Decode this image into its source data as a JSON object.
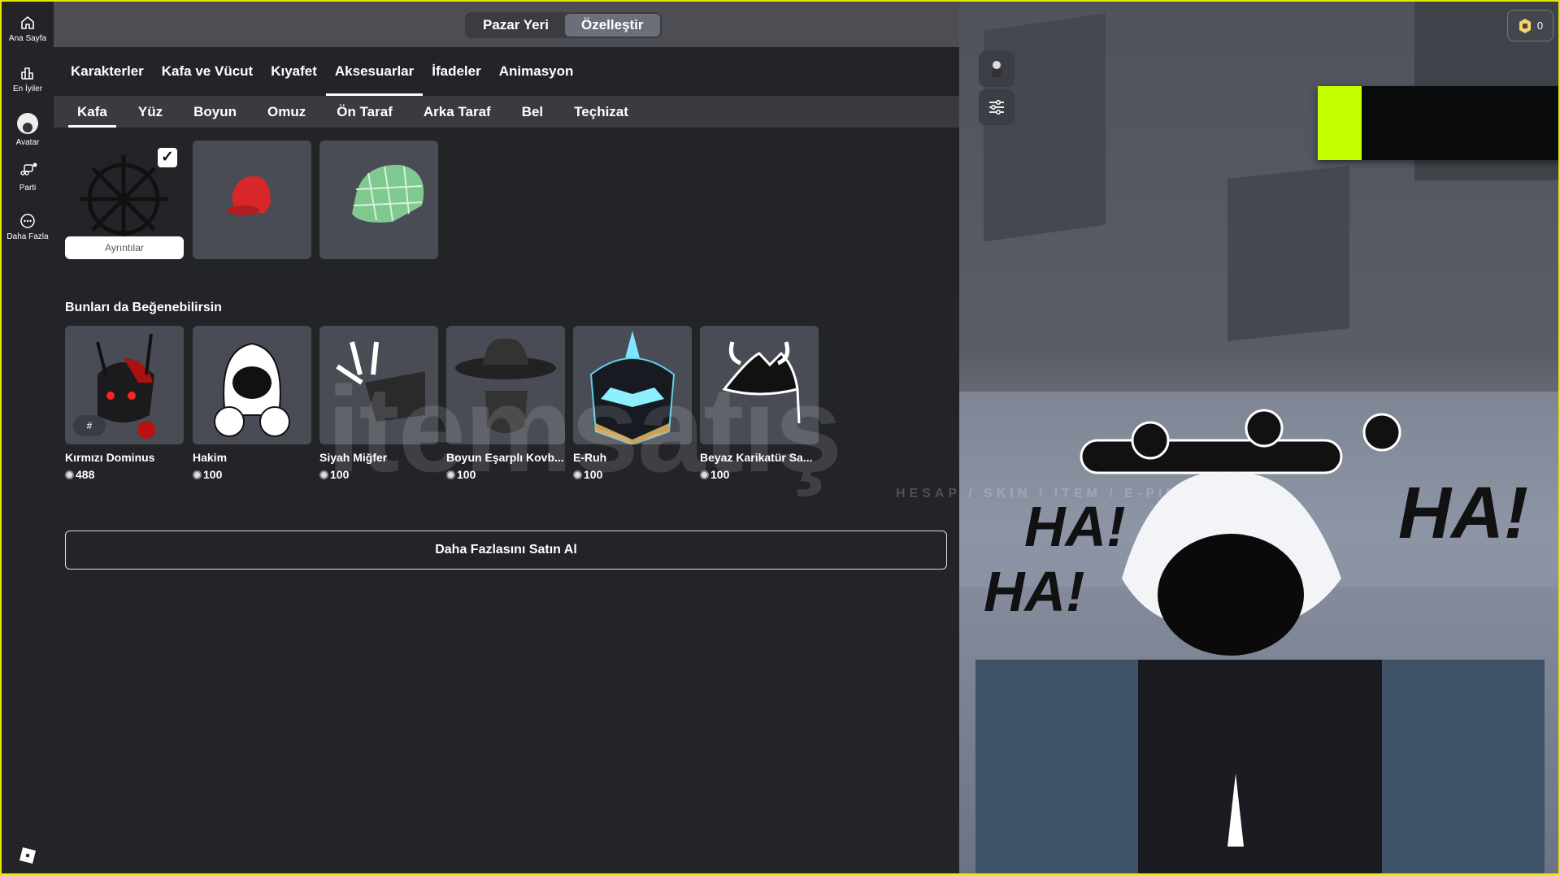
{
  "sidebar": {
    "items": [
      {
        "label": "Ana Sayfa",
        "icon": "home-icon"
      },
      {
        "label": "En İyiler",
        "icon": "chart-icon"
      },
      {
        "label": "Avatar",
        "icon": "avatar-icon"
      },
      {
        "label": "Parti",
        "icon": "party-icon"
      },
      {
        "label": "Daha Fazla",
        "icon": "more-icon"
      }
    ]
  },
  "header": {
    "tabs": [
      {
        "label": "Pazar Yeri"
      },
      {
        "label": "Özelleştir"
      }
    ]
  },
  "categories": [
    "Karakterler",
    "Kafa ve Vücut",
    "Kıyafet",
    "Aksesuarlar",
    "İfadeler",
    "Animasyon"
  ],
  "subcategories": [
    "Kafa",
    "Yüz",
    "Boyun",
    "Omuz",
    "Ön Taraf",
    "Arka Taraf",
    "Bel",
    "Teçhizat"
  ],
  "equipped": {
    "details_label": "Ayrıntılar",
    "checked": true
  },
  "recommendations": {
    "title": "Bunları da Beğenebilirsin",
    "items": [
      {
        "name": "Kırmızı Dominus",
        "price": "488",
        "badge": "#"
      },
      {
        "name": "Hakim",
        "price": "100"
      },
      {
        "name": "Siyah Miğfer",
        "price": "100"
      },
      {
        "name": "Boyun Eşarplı Kovb...",
        "price": "100"
      },
      {
        "name": "E-Ruh",
        "price": "100"
      },
      {
        "name": "Beyaz Karikatür Sa...",
        "price": "100"
      }
    ]
  },
  "more_button": "Daha Fazlasını Satın Al",
  "robux": {
    "balance": "0"
  },
  "watermark": {
    "text": "itemsatış",
    "sub": "HESAP / SKIN / ITEM / E-PIN"
  },
  "colors": {
    "accent": "#c4ff00",
    "panel": "#232428",
    "card": "#4a4c55"
  }
}
